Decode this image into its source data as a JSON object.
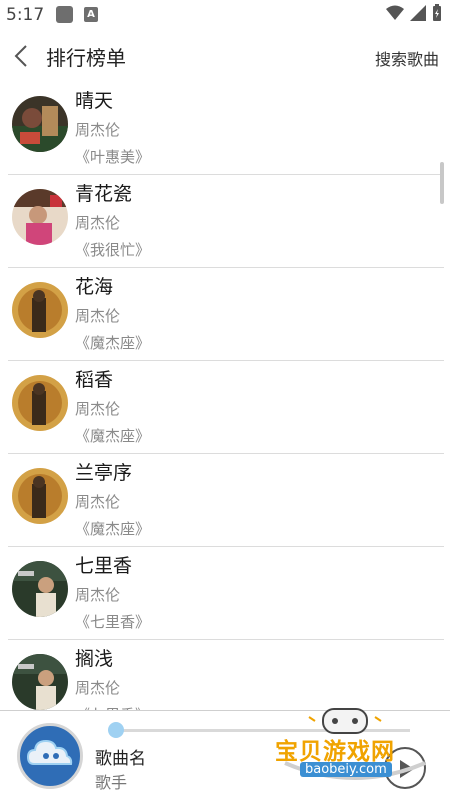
{
  "status_bar": {
    "time": "5:17"
  },
  "header": {
    "title": "排行榜单",
    "search_label": "搜索歌曲"
  },
  "songs": [
    {
      "title": "晴天",
      "artist": "周杰伦",
      "album": "《叶惠美》"
    },
    {
      "title": "青花瓷",
      "artist": "周杰伦",
      "album": "《我很忙》"
    },
    {
      "title": "花海",
      "artist": "周杰伦",
      "album": "《魔杰座》"
    },
    {
      "title": "稻香",
      "artist": "周杰伦",
      "album": "《魔杰座》"
    },
    {
      "title": "兰亭序",
      "artist": "周杰伦",
      "album": "《魔杰座》"
    },
    {
      "title": "七里香",
      "artist": "周杰伦",
      "album": "《七里香》"
    },
    {
      "title": "搁浅",
      "artist": "周杰伦",
      "album": "《七里香》"
    }
  ],
  "player": {
    "song_label": "歌曲名",
    "artist_label": "歌手",
    "progress_fraction": 0.0
  },
  "watermark": {
    "text": "宝贝游戏网",
    "url": "baobeiy.com"
  },
  "colors": {
    "accent": "#9fd1f2",
    "player_cover": "#2f6db6"
  }
}
